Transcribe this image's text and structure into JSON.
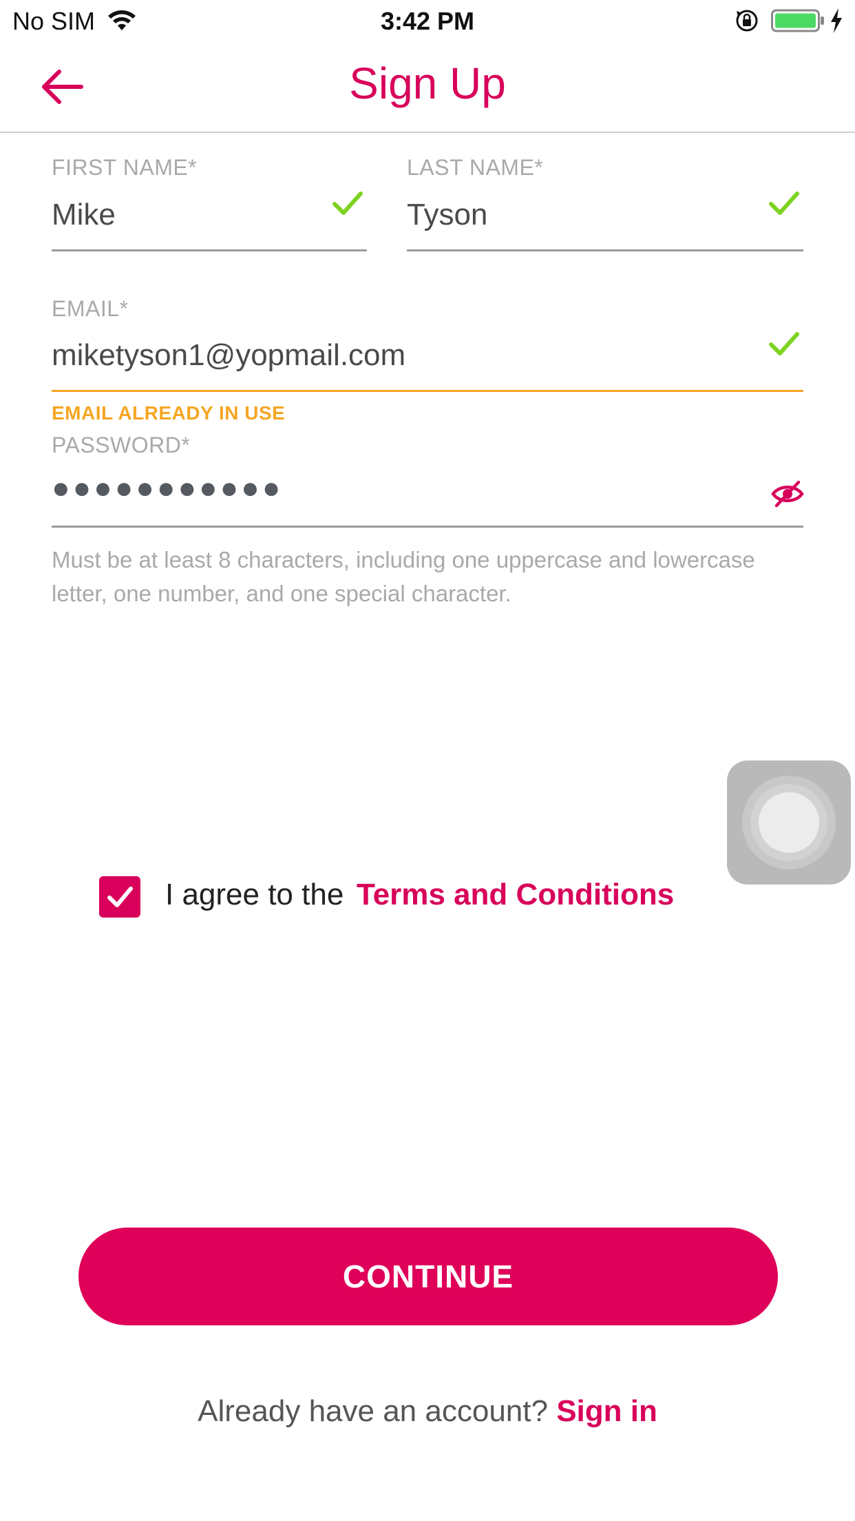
{
  "status_bar": {
    "carrier": "No SIM",
    "time": "3:42 PM",
    "icons": [
      "wifi-icon",
      "rotation-lock-icon",
      "battery-icon",
      "charging-icon"
    ]
  },
  "header": {
    "title": "Sign Up",
    "back_icon": "arrow-left-icon"
  },
  "form": {
    "first_name": {
      "label": "FIRST NAME*",
      "value": "Mike",
      "valid": true
    },
    "last_name": {
      "label": "LAST NAME*",
      "value": "Tyson",
      "valid": true
    },
    "email": {
      "label": "EMAIL*",
      "value": "miketyson1@yopmail.com",
      "valid": true,
      "error": "EMAIL ALREADY IN USE"
    },
    "password": {
      "label": "PASSWORD*",
      "masked_value": "●●●●●●●●●●●",
      "toggle_icon": "eye-slash-icon",
      "hint": "Must be at least 8 characters, including one uppercase and lowercase letter, one number, and one special character."
    }
  },
  "agree": {
    "checked": true,
    "text": "I agree to the",
    "link": "Terms and Conditions"
  },
  "actions": {
    "continue_label": "CONTINUE"
  },
  "footer": {
    "prompt": "Already have an account?",
    "signin_label": "Sign in"
  },
  "colors": {
    "accent": "#d8005a",
    "valid": "#7ed321",
    "warning": "#f5a623"
  }
}
